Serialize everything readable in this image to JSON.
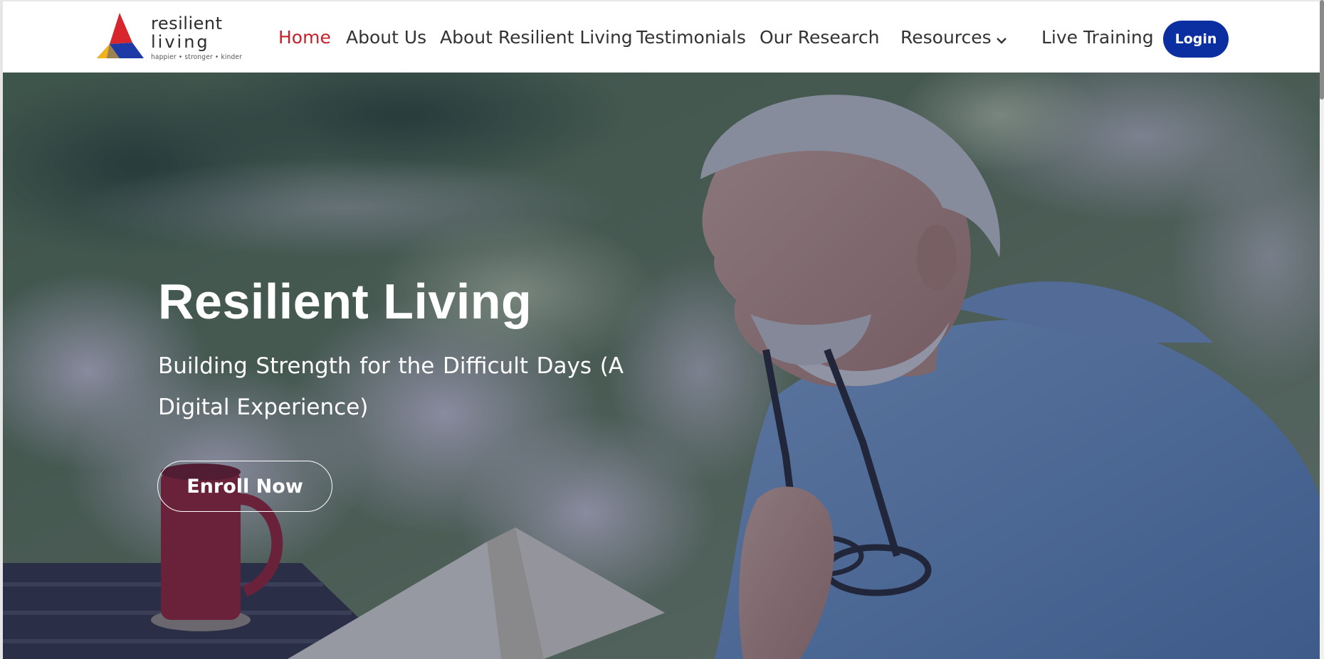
{
  "logo": {
    "line1": "resilient",
    "line2": "living",
    "tagline": "happier • stronger • kinder",
    "colors": {
      "red": "#d7262e",
      "yellow": "#f2b31a",
      "blue": "#1d3aa6",
      "dark": "#2d2d2d"
    }
  },
  "nav": {
    "items": [
      {
        "label": "Home",
        "active": true
      },
      {
        "label": "About Us",
        "active": false
      },
      {
        "label": "About Resilient Living",
        "active": false
      },
      {
        "label": "Testimonials",
        "active": false
      },
      {
        "label": "Our Research",
        "active": false
      },
      {
        "label": "Resources",
        "active": false,
        "dropdown": true
      },
      {
        "label": "Live Training",
        "active": false
      }
    ],
    "login_label": "Login",
    "active_color": "#c8202a",
    "login_color": "#0b2fa0"
  },
  "hero": {
    "title": "Resilient Living",
    "subtitle": "Building Strength for the Difficult Days (A Digital Experience)",
    "cta_label": "Enroll Now",
    "image": "older man reading a book, holding glasses, outdoor garden with red mug"
  }
}
